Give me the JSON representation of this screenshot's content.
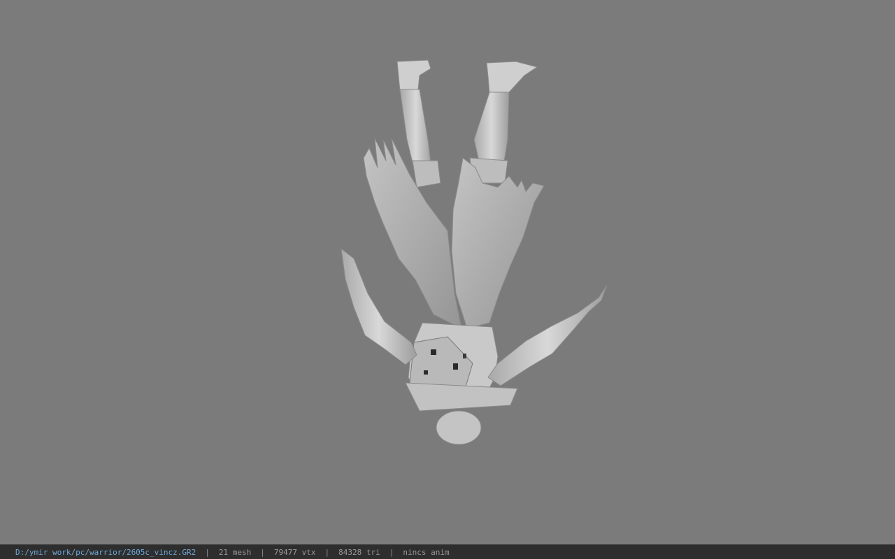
{
  "status": {
    "file_path": "D:/ymir work/pc/warrior/2605c_vincz.GR2",
    "separator": "|",
    "mesh_count": "21 mesh",
    "vertex_count": "79477 vtx",
    "triangle_count": "84328 tri",
    "anim_status": "nincs anim"
  },
  "colors": {
    "viewport_bg": "#7b7b7b",
    "statusbar_bg": "#2e2e2e",
    "path_text": "#6fa8d8"
  }
}
